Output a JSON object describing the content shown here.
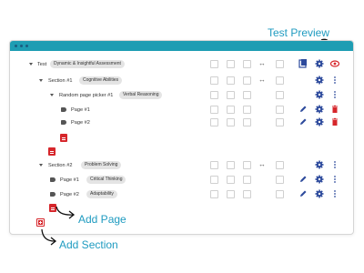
{
  "annotations": {
    "test_preview": "Test Preview",
    "add_page": "Add Page",
    "add_section": "Add Section"
  },
  "colors": {
    "titlebar": "#1e9db3",
    "accent_blue": "#2d4a9c",
    "danger_red": "#d6262b",
    "annotation_text": "#1f9bc0"
  },
  "rows": {
    "test": {
      "label": "Test",
      "pill": "Dynamic & Insightful Assessment"
    },
    "section1": {
      "label": "Section #1",
      "pill": "Cognitive Abilities"
    },
    "picker1": {
      "label": "Random page picker #1",
      "pill": "Verbal Reasoning"
    },
    "picker_page1": {
      "label": "Page #1"
    },
    "picker_page2": {
      "label": "Page #2"
    },
    "section2": {
      "label": "Section #2",
      "pill": "Problem Solving"
    },
    "sec2_page1": {
      "label": "Page #1",
      "pill": "Critical Thinking"
    },
    "sec2_page2": {
      "label": "Page #2",
      "pill": "Adaptability"
    }
  },
  "icons": {
    "move": "↔",
    "caret": "caret-down-icon",
    "tag": "tag-icon",
    "edit": "pencil-icon",
    "settings": "gear-icon",
    "more": "more-vert-icon",
    "delete": "trash-icon",
    "preview": "eye-icon",
    "bank": "question-bank-icon",
    "add_page": "add-page-icon",
    "add_section": "add-section-icon"
  }
}
